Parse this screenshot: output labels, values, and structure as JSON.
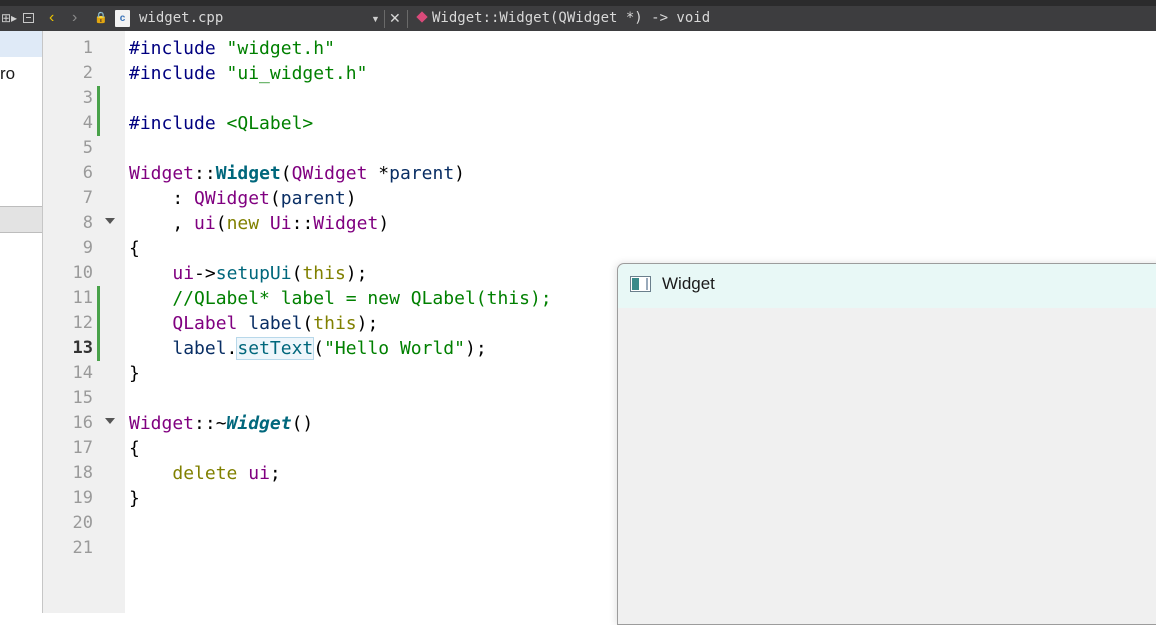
{
  "toolbar": {
    "split_icon": "split-icon",
    "split_glyph": "⊞▸",
    "back_glyph": "‹",
    "forward_glyph": "›",
    "lock_glyph": "🔒",
    "file_icon_glyph": "c",
    "file_name": "widget.cpp",
    "dropdown_glyph": "▼",
    "close_glyph": "✕",
    "symbol": "Widget::Widget(QWidget *) -> void"
  },
  "sidebar": {
    "partial_text": "ro"
  },
  "editor": {
    "current_line": 13,
    "line_numbers": [
      "1",
      "2",
      "3",
      "4",
      "5",
      "6",
      "7",
      "8",
      "9",
      "10",
      "11",
      "12",
      "13",
      "14",
      "15",
      "16",
      "17",
      "18",
      "19",
      "20",
      "21"
    ],
    "code": {
      "l1": [
        "#include ",
        "\"widget.h\""
      ],
      "l2": [
        "#include ",
        "\"ui_widget.h\""
      ],
      "l4": [
        "#include ",
        "<QLabel>"
      ],
      "l6": [
        "Widget",
        "::",
        "Widget",
        "(",
        "QWidget",
        " *",
        "parent",
        ")"
      ],
      "l7": [
        "    : ",
        "QWidget",
        "(",
        "parent",
        ")"
      ],
      "l8": [
        "    , ",
        "ui",
        "(",
        "new",
        " ",
        "Ui",
        "::",
        "Widget",
        ")"
      ],
      "l9": [
        "{"
      ],
      "l10": [
        "    ",
        "ui",
        "->",
        "setupUi",
        "(",
        "this",
        ");"
      ],
      "l11": [
        "    //QLabel* label = new QLabel(this);"
      ],
      "l12": [
        "    ",
        "QLabel",
        " ",
        "label",
        "(",
        "this",
        ");"
      ],
      "l13": [
        "    ",
        "label",
        ".",
        "setText",
        "(",
        "\"Hello World\"",
        ");"
      ],
      "l14": [
        "}"
      ],
      "l16": [
        "Widget",
        "::~",
        "Widget",
        "()"
      ],
      "l17": [
        "{"
      ],
      "l18": [
        "    ",
        "delete",
        " ",
        "ui",
        ";"
      ],
      "l19": [
        "}"
      ]
    }
  },
  "widget_window": {
    "title": "Widget"
  }
}
